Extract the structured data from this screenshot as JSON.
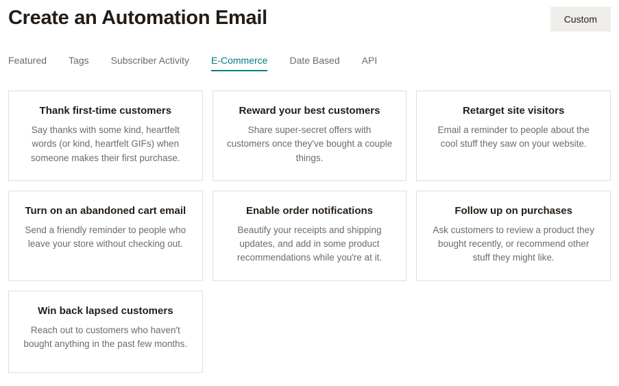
{
  "header": {
    "title": "Create an Automation Email",
    "custom_button": "Custom"
  },
  "tabs": [
    {
      "label": "Featured",
      "active": false
    },
    {
      "label": "Tags",
      "active": false
    },
    {
      "label": "Subscriber Activity",
      "active": false
    },
    {
      "label": "E-Commerce",
      "active": true
    },
    {
      "label": "Date Based",
      "active": false
    },
    {
      "label": "API",
      "active": false
    }
  ],
  "cards": [
    {
      "title": "Thank first-time customers",
      "desc": "Say thanks with some kind, heartfelt words (or kind, heartfelt GIFs) when someone makes their first purchase."
    },
    {
      "title": "Reward your best customers",
      "desc": "Share super-secret offers with customers once they've bought a couple things."
    },
    {
      "title": "Retarget site visitors",
      "desc": "Email a reminder to people about the cool stuff they saw on your website."
    },
    {
      "title": "Turn on an abandoned cart email",
      "desc": "Send a friendly reminder to people who leave your store without checking out."
    },
    {
      "title": "Enable order notifications",
      "desc": "Beautify your receipts and shipping updates, and add in some product recommendations while you're at it."
    },
    {
      "title": "Follow up on purchases",
      "desc": "Ask customers to review a product they bought recently, or recommend other stuff they might like."
    },
    {
      "title": "Win back lapsed customers",
      "desc": "Reach out to customers who haven't bought anything in the past few months."
    }
  ]
}
